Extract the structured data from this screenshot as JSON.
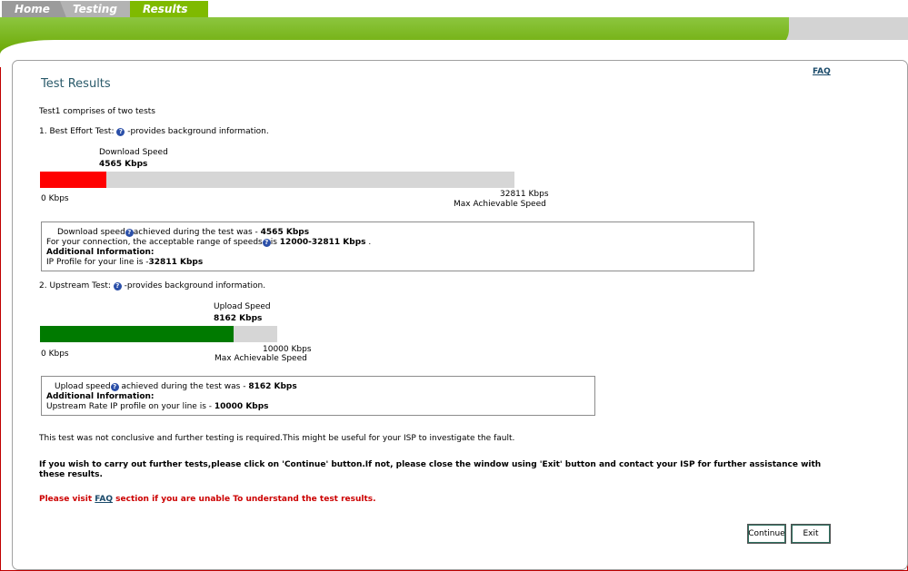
{
  "tabs": [
    {
      "label": "Home"
    },
    {
      "label": "Testing"
    },
    {
      "label": "Results"
    }
  ],
  "page": {
    "title": "Test Results",
    "faq_label": "FAQ",
    "intro": "Test1 comprises of two tests"
  },
  "test1": {
    "heading_prefix": "1. Best Effort Test: ",
    "heading_suffix": " -provides background information.",
    "speed_label": "Download Speed",
    "speed_value": "4565 Kbps",
    "bar_fraction": 0.139,
    "bar_color": "#ff0000",
    "min_label": "0 Kbps",
    "max_value": "32811 Kbps",
    "max_caption": "Max Achievable Speed",
    "info": {
      "line1_prefix": "Download speed",
      "line1_mid": "achieved during the test was - ",
      "line1_value": "4565 Kbps",
      "line2_prefix": "For your connection, the acceptable range of speeds",
      "line2_mid": "is ",
      "line2_value": "12000-32811 Kbps",
      "line2_suffix": " .",
      "additional": "Additional Information:",
      "line4_prefix": "IP Profile for your line is -",
      "line4_value": "32811 Kbps"
    }
  },
  "test2": {
    "heading_prefix": "2. Upstream Test: ",
    "heading_suffix": " -provides background information.",
    "speed_label": "Upload Speed",
    "speed_value": "8162 Kbps",
    "bar_fraction": 0.816,
    "bar_color": "#007a00",
    "min_label": "0 Kbps",
    "max_value": "10000 Kbps",
    "max_caption": "Max Achievable Speed",
    "info": {
      "line1_prefix": "Upload speed",
      "line1_mid": " achieved during the test was - ",
      "line1_value": "8162 Kbps",
      "additional": "Additional Information:",
      "line3_prefix": "Upstream Rate IP profile on your line is - ",
      "line3_value": "10000 Kbps"
    }
  },
  "messages": {
    "inconclusive": "This test was not conclusive and further testing is required.This might be useful for your ISP to investigate the fault.",
    "continue_line1": "If you wish to carry out further tests,please click on 'Continue' button.If not, please close the window using 'Exit' button and contact your ISP for further assistance with",
    "continue_line2": "these results.",
    "visit_prefix": "Please visit ",
    "visit_link": "FAQ",
    "visit_suffix": " section if you are unable To understand the test results."
  },
  "buttons": {
    "continue_label": "Continue",
    "exit_label": "Exit"
  },
  "colors": {
    "accent_green": "#7fba00",
    "warning_red": "#cc0000"
  }
}
